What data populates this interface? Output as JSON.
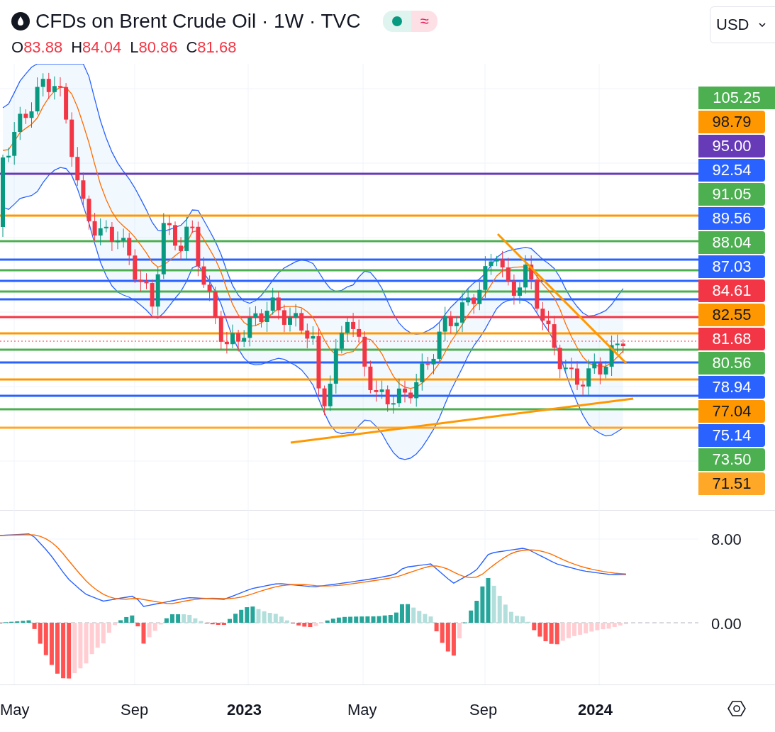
{
  "header": {
    "title": "CFDs on Brent Crude Oil · 1W · TVC",
    "status_symbol": "≈",
    "ohlc": [
      {
        "label": "O",
        "value": "83.88"
      },
      {
        "label": "H",
        "value": "84.04"
      },
      {
        "label": "L",
        "value": "80.86"
      },
      {
        "label": "C",
        "value": "81.68"
      }
    ]
  },
  "currency": "USD",
  "price_labels": [
    {
      "value": "105.25",
      "color": "#4caf50"
    },
    {
      "value": "98.79",
      "color": "#ff9800"
    },
    {
      "value": "95.00",
      "color": "#673ab7"
    },
    {
      "value": "92.54",
      "color": "#2962ff"
    },
    {
      "value": "91.05",
      "color": "#4caf50"
    },
    {
      "value": "89.56",
      "color": "#2962ff"
    },
    {
      "value": "88.04",
      "color": "#4caf50"
    },
    {
      "value": "87.03",
      "color": "#2962ff"
    },
    {
      "value": "84.61",
      "color": "#f23645"
    },
    {
      "value": "82.55",
      "color": "#ff9800"
    },
    {
      "value": "81.68",
      "color": "#f23645"
    },
    {
      "value": "80.56",
      "color": "#4caf50"
    },
    {
      "value": "78.94",
      "color": "#2962ff"
    },
    {
      "value": "77.04",
      "color": "#ff9800"
    },
    {
      "value": "75.14",
      "color": "#2962ff"
    },
    {
      "value": "73.50",
      "color": "#4caf50"
    },
    {
      "value": "71.51",
      "color": "#ffa726"
    }
  ],
  "macd_axis": [
    "8.00",
    "0.00"
  ],
  "time_axis": [
    {
      "label": "May",
      "kind": "month"
    },
    {
      "label": "Sep",
      "kind": "month"
    },
    {
      "label": "2023",
      "kind": "year"
    },
    {
      "label": "May",
      "kind": "month"
    },
    {
      "label": "Sep",
      "kind": "month"
    },
    {
      "label": "2024",
      "kind": "year"
    }
  ]
}
